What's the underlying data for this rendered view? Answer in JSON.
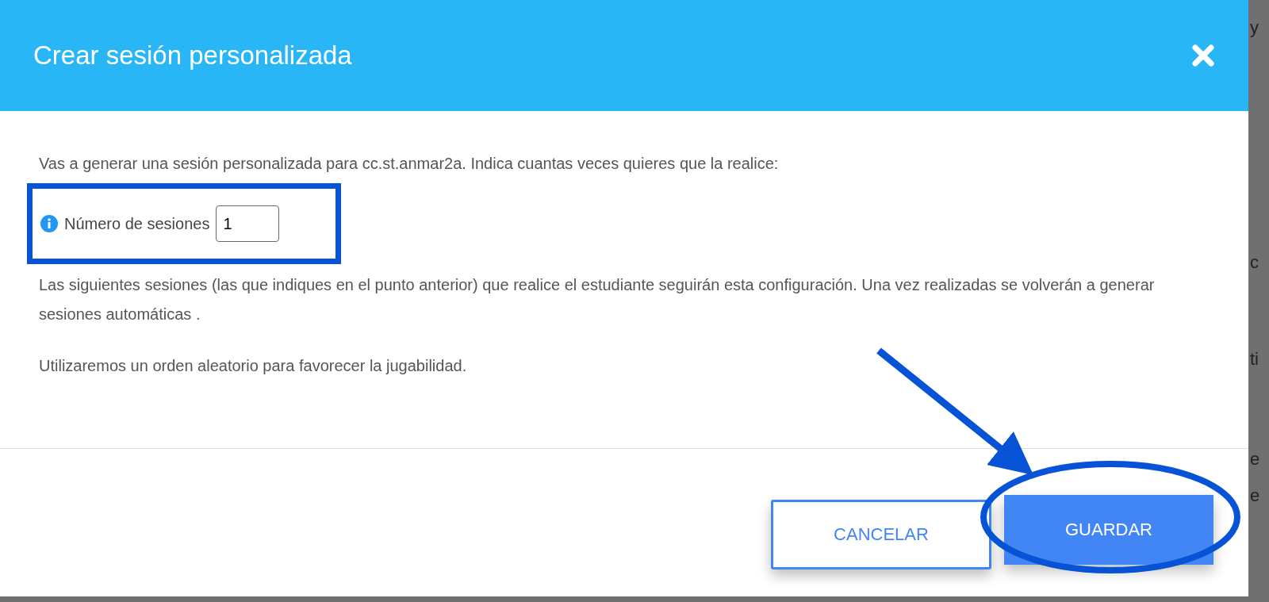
{
  "dialog": {
    "title": "Crear sesión personalizada",
    "intro": "Vas a generar una sesión personalizada para cc.st.anmar2a. Indica cuantas veces quieres que la realice:",
    "sessions_field": {
      "label": "Número de sesiones",
      "value": "1"
    },
    "paragraphs": [
      "Las siguientes sesiones (las que indiques en el punto anterior) que realice el estudiante seguirán esta configuración. Una vez realizadas se volverán a generar sesiones automáticas .",
      "Utilizaremos un orden aleatorio para favorecer la jugabilidad."
    ],
    "buttons": [
      {
        "label": "CANCELAR",
        "kind": "secondary"
      },
      {
        "label": "GUARDAR",
        "kind": "primary"
      }
    ]
  },
  "background_fragments": [
    "y",
    "c",
    "ti",
    "e",
    "e"
  ]
}
